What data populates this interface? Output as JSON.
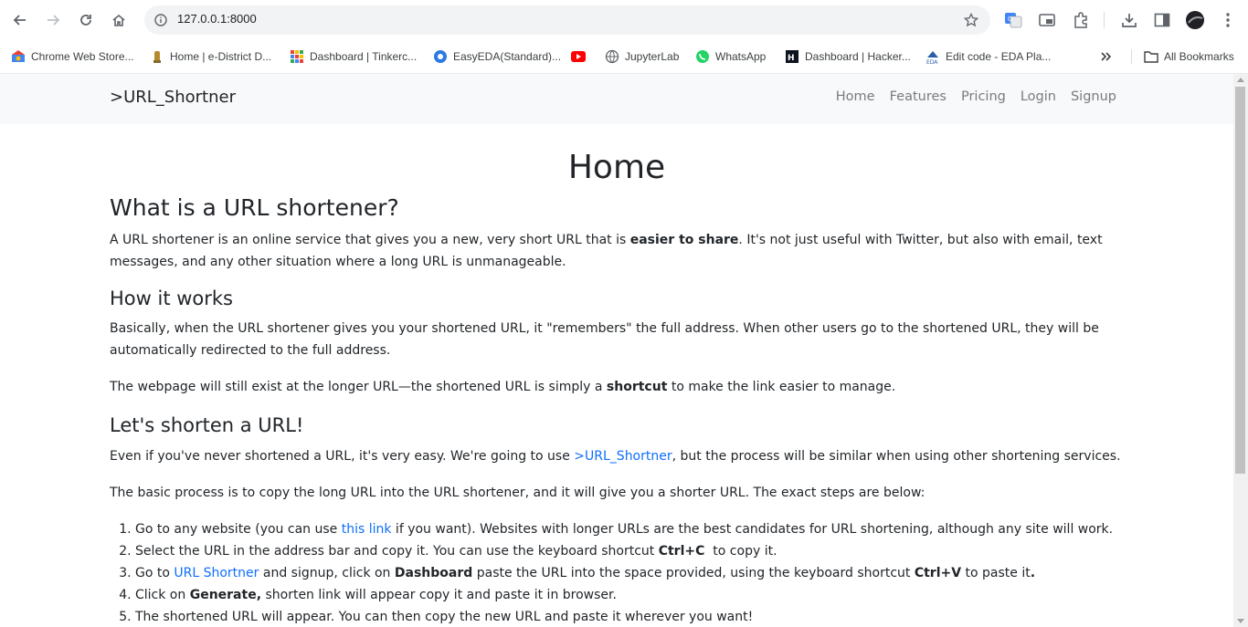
{
  "browser": {
    "url": "127.0.0.1:8000",
    "bookmarks": [
      {
        "label": "Chrome Web Store..."
      },
      {
        "label": "Home | e-District D..."
      },
      {
        "label": "Dashboard | Tinkerc..."
      },
      {
        "label": "EasyEDA(Standard)..."
      },
      {
        "label": ""
      },
      {
        "label": "JupyterLab"
      },
      {
        "label": "WhatsApp"
      },
      {
        "label": "Dashboard | Hacker..."
      },
      {
        "label": "Edit code - EDA Pla..."
      }
    ],
    "all_bookmarks": "All Bookmarks"
  },
  "site": {
    "brand": ">URL_Shortner",
    "nav": [
      "Home",
      "Features",
      "Pricing",
      "Login",
      "Signup"
    ]
  },
  "page": {
    "title": "Home",
    "s1_heading": "What is a URL shortener?",
    "s1_p_a": "A URL shortener is an online service that gives you a new, very short URL that is ",
    "s1_p_b": "easier to share",
    "s1_p_c": ". It's not just useful with Twitter, but also with email, text messages, and any other situation where a long URL is unmanageable.",
    "s2_heading": "How it works",
    "s2_p1": "Basically, when the URL shortener gives you your shortened URL, it \"remembers\" the full address. When other users go to the shortened URL, they will be automatically redirected to the full address.",
    "s2_p2_a": "The webpage will still exist at the longer URL—the shortened URL is simply a ",
    "s2_p2_b": "shortcut",
    "s2_p2_c": " to make the link easier to manage.",
    "s3_heading": "Let's shorten a URL!",
    "s3_p1_a": "Even if you've never shortened a URL, it's very easy. We're going to use ",
    "s3_p1_link": ">URL_Shortner",
    "s3_p1_b": ", but the process will be similar when using other shortening services.",
    "s3_p2": "The basic process is to copy the long URL into the URL shortener, and it will give you a shorter URL. The exact steps are below:",
    "step1_a": "Go to any website (you can use ",
    "step1_link": "this link",
    "step1_b": " if you want). Websites with longer URLs are the best candidates for URL shortening, although any site will work.",
    "step2_a": "Select the URL in the address bar and copy it. You can use the keyboard shortcut ",
    "step2_b": "Ctrl+C",
    "step2_c": "  to copy it.",
    "step3_a": "Go to ",
    "step3_link": "URL Shortner",
    "step3_b": " and signup, click on ",
    "step3_c": "Dashboard",
    "step3_d": " paste the URL into the space provided, using the keyboard shortcut ",
    "step3_e": "Ctrl+V",
    "step3_f": " to paste it",
    "step3_g": ".",
    "step4_a": "Click on ",
    "step4_b": "Generate,",
    "step4_c": " shorten link will appear copy it and paste it in browser.",
    "step5": "The shortened URL will appear. You can then copy the new URL and paste it wherever you want!"
  }
}
